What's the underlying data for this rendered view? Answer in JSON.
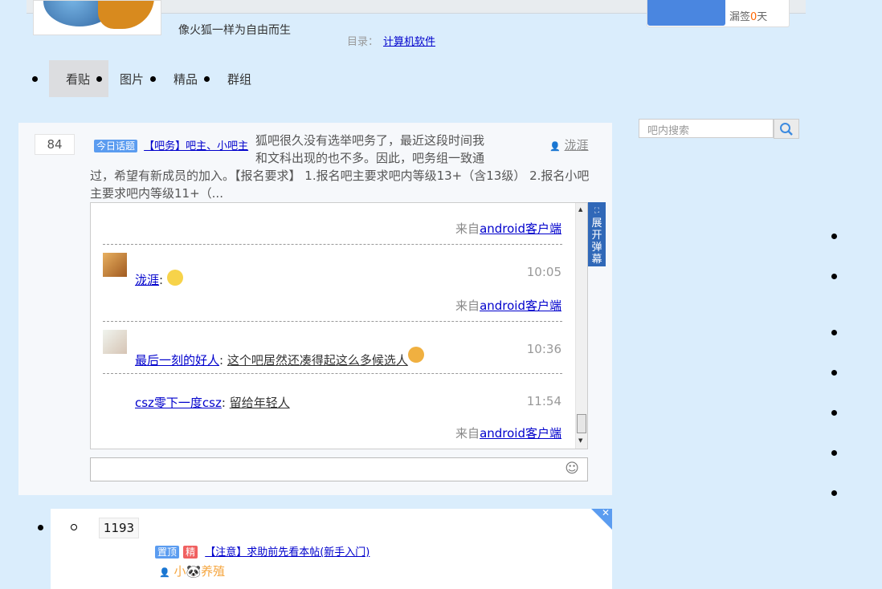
{
  "header": {
    "slogan": "像火狐一样为自由而生",
    "dir_label": "目录：",
    "dir_link": "计算机软件",
    "sign_text_a": "漏签",
    "sign_days": "0",
    "sign_text_b": "天"
  },
  "nav": {
    "items": [
      {
        "label": "看贴"
      },
      {
        "label": "图片"
      },
      {
        "label": "精品"
      },
      {
        "label": "群组"
      }
    ]
  },
  "search": {
    "placeholder": "吧内搜索"
  },
  "thread1": {
    "reply_count": "84",
    "badge": "今日话题",
    "title": "【吧务】吧主、小吧主",
    "abstract_lines": [
      "狐吧很久没有选举吧务了，最近这段时间我",
      "和文科出现的也不多。因此，吧务组一致通"
    ],
    "abstract_rest": "过，希望有新成员的加入。【报名要求】 1.报名吧主要求吧内等级13+（含13级） 2.报名小吧主要求吧内等级11+（...",
    "author": "泷涯",
    "danmu_button": "展开弹幕",
    "comments": [
      {
        "from_label": "来自",
        "from_link": "android客户端"
      },
      {
        "user": "泷涯",
        "text": "",
        "time": "10:05",
        "from_label": "来自",
        "from_link": "android客户端"
      },
      {
        "user": "最后一刻的好人",
        "text": "这个吧居然还凑得起这么多候选人",
        "time": "10:36"
      },
      {
        "user": "csz零下一度csz",
        "text": "留给年轻人",
        "time": "11:54",
        "from_label": "来自",
        "from_link": "android客户端"
      }
    ]
  },
  "thread2": {
    "reply_count": "1193",
    "badge_top": "置顶",
    "badge_good": "精",
    "title": "【注意】求助前先看本帖(新手入门)",
    "author": "小🐼养殖"
  },
  "colors": {
    "bg": "#daedfc",
    "accent": "#4a86e0",
    "danmu": "#3068b8"
  }
}
